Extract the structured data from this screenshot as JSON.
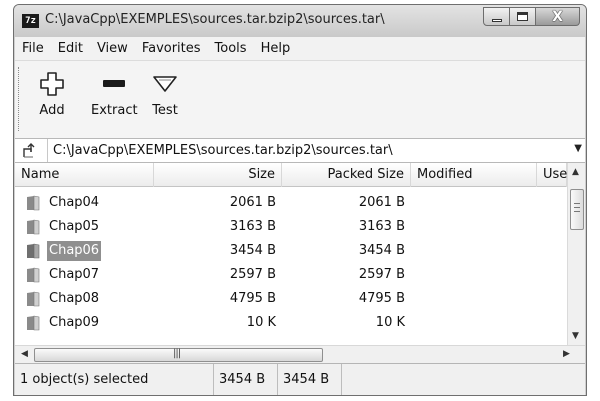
{
  "window": {
    "app_icon_text": "7z",
    "title": "C:\\JavaCpp\\EXEMPLES\\sources.tar.bzip2\\sources.tar\\",
    "controls": {
      "minimize_icon": "minimize-icon",
      "maximize_icon": "maximize-icon",
      "close_icon": "close-icon",
      "close_label": "X"
    }
  },
  "menu": {
    "items": [
      "File",
      "Edit",
      "View",
      "Favorites",
      "Tools",
      "Help"
    ]
  },
  "toolbar": {
    "add_label": "Add",
    "extract_label": "Extract",
    "test_label": "Test"
  },
  "address": {
    "path": "C:\\JavaCpp\\EXEMPLES\\sources.tar.bzip2\\sources.tar\\"
  },
  "list": {
    "columns": [
      "Name",
      "Size",
      "Packed Size",
      "Modified",
      "User"
    ],
    "rows": [
      {
        "name": "Chap04",
        "size": "2061 B",
        "packed": "2061 B",
        "modified": "",
        "user": "",
        "selected": false
      },
      {
        "name": "Chap05",
        "size": "3163 B",
        "packed": "3163 B",
        "modified": "",
        "user": "",
        "selected": false
      },
      {
        "name": "Chap06",
        "size": "3454 B",
        "packed": "3454 B",
        "modified": "",
        "user": "",
        "selected": true
      },
      {
        "name": "Chap07",
        "size": "2597 B",
        "packed": "2597 B",
        "modified": "",
        "user": "",
        "selected": false
      },
      {
        "name": "Chap08",
        "size": "4795 B",
        "packed": "4795 B",
        "modified": "",
        "user": "",
        "selected": false
      },
      {
        "name": "Chap09",
        "size": "10 K",
        "packed": "10 K",
        "modified": "",
        "user": "",
        "selected": false
      }
    ]
  },
  "status": {
    "selection": "1 object(s) selected",
    "size": "3454 B",
    "packed_size": "3454 B"
  },
  "colors": {
    "selection_bg": "#8f8f8f",
    "window_frame": "#cfcfcf"
  }
}
